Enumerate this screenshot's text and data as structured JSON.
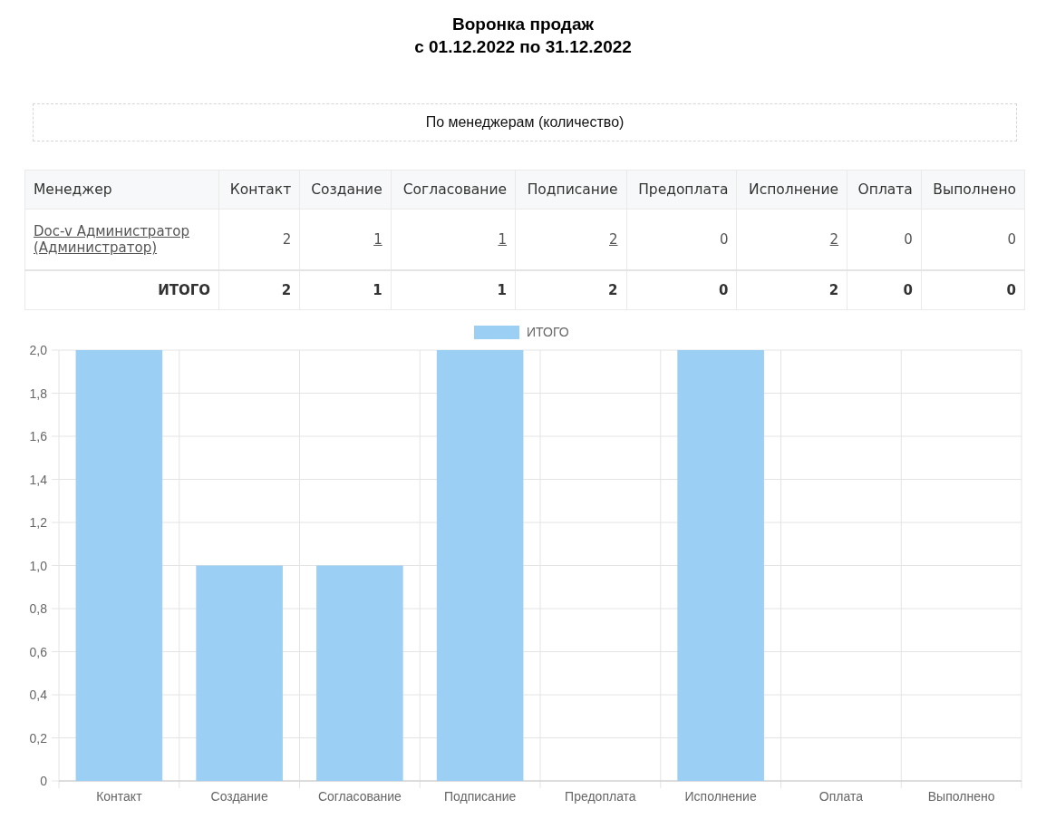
{
  "title": "Воронка продаж",
  "period": "с 01.12.2022 по 31.12.2022",
  "section": "По менеджерам (количество)",
  "table": {
    "columns": [
      "Менеджер",
      "Контакт",
      "Создание",
      "Согласование",
      "Подписание",
      "Предоплата",
      "Исполнение",
      "Оплата",
      "Выполнено"
    ],
    "rows": [
      {
        "kind": "data",
        "cells": [
          {
            "text": "Doc-v Администратор (Администратор)",
            "link": true
          },
          {
            "text": "2",
            "link": false
          },
          {
            "text": "1",
            "link": true
          },
          {
            "text": "1",
            "link": true
          },
          {
            "text": "2",
            "link": true
          },
          {
            "text": "0",
            "link": false
          },
          {
            "text": "2",
            "link": true
          },
          {
            "text": "0",
            "link": false
          },
          {
            "text": "0",
            "link": false
          }
        ]
      },
      {
        "kind": "total",
        "cells": [
          {
            "text": "ИТОГО",
            "link": false
          },
          {
            "text": "2",
            "link": false
          },
          {
            "text": "1",
            "link": false
          },
          {
            "text": "1",
            "link": false
          },
          {
            "text": "2",
            "link": false
          },
          {
            "text": "0",
            "link": false
          },
          {
            "text": "2",
            "link": false
          },
          {
            "text": "0",
            "link": false
          },
          {
            "text": "0",
            "link": false
          }
        ]
      }
    ]
  },
  "chart_data": {
    "type": "bar",
    "grid": true,
    "categories": [
      "Контакт",
      "Создание",
      "Согласование",
      "Подписание",
      "Предоплата",
      "Исполнение",
      "Оплата",
      "Выполнено"
    ],
    "series": [
      {
        "name": "ИТОГО",
        "color": "#9bcff3",
        "values": [
          2,
          1,
          1,
          2,
          0,
          2,
          0,
          0
        ]
      }
    ],
    "ylim": [
      0,
      2
    ],
    "yticks": [
      {
        "value": 0,
        "label": "0"
      },
      {
        "value": 0.2,
        "label": "0,2"
      },
      {
        "value": 0.4,
        "label": "0,4"
      },
      {
        "value": 0.6,
        "label": "0,6"
      },
      {
        "value": 0.8,
        "label": "0,8"
      },
      {
        "value": 1,
        "label": "1,0"
      },
      {
        "value": 1.2,
        "label": "1,2"
      },
      {
        "value": 1.4,
        "label": "1,4"
      },
      {
        "value": 1.6,
        "label": "1,6"
      },
      {
        "value": 1.8,
        "label": "1,8"
      },
      {
        "value": 2,
        "label": "2,0"
      }
    ]
  }
}
